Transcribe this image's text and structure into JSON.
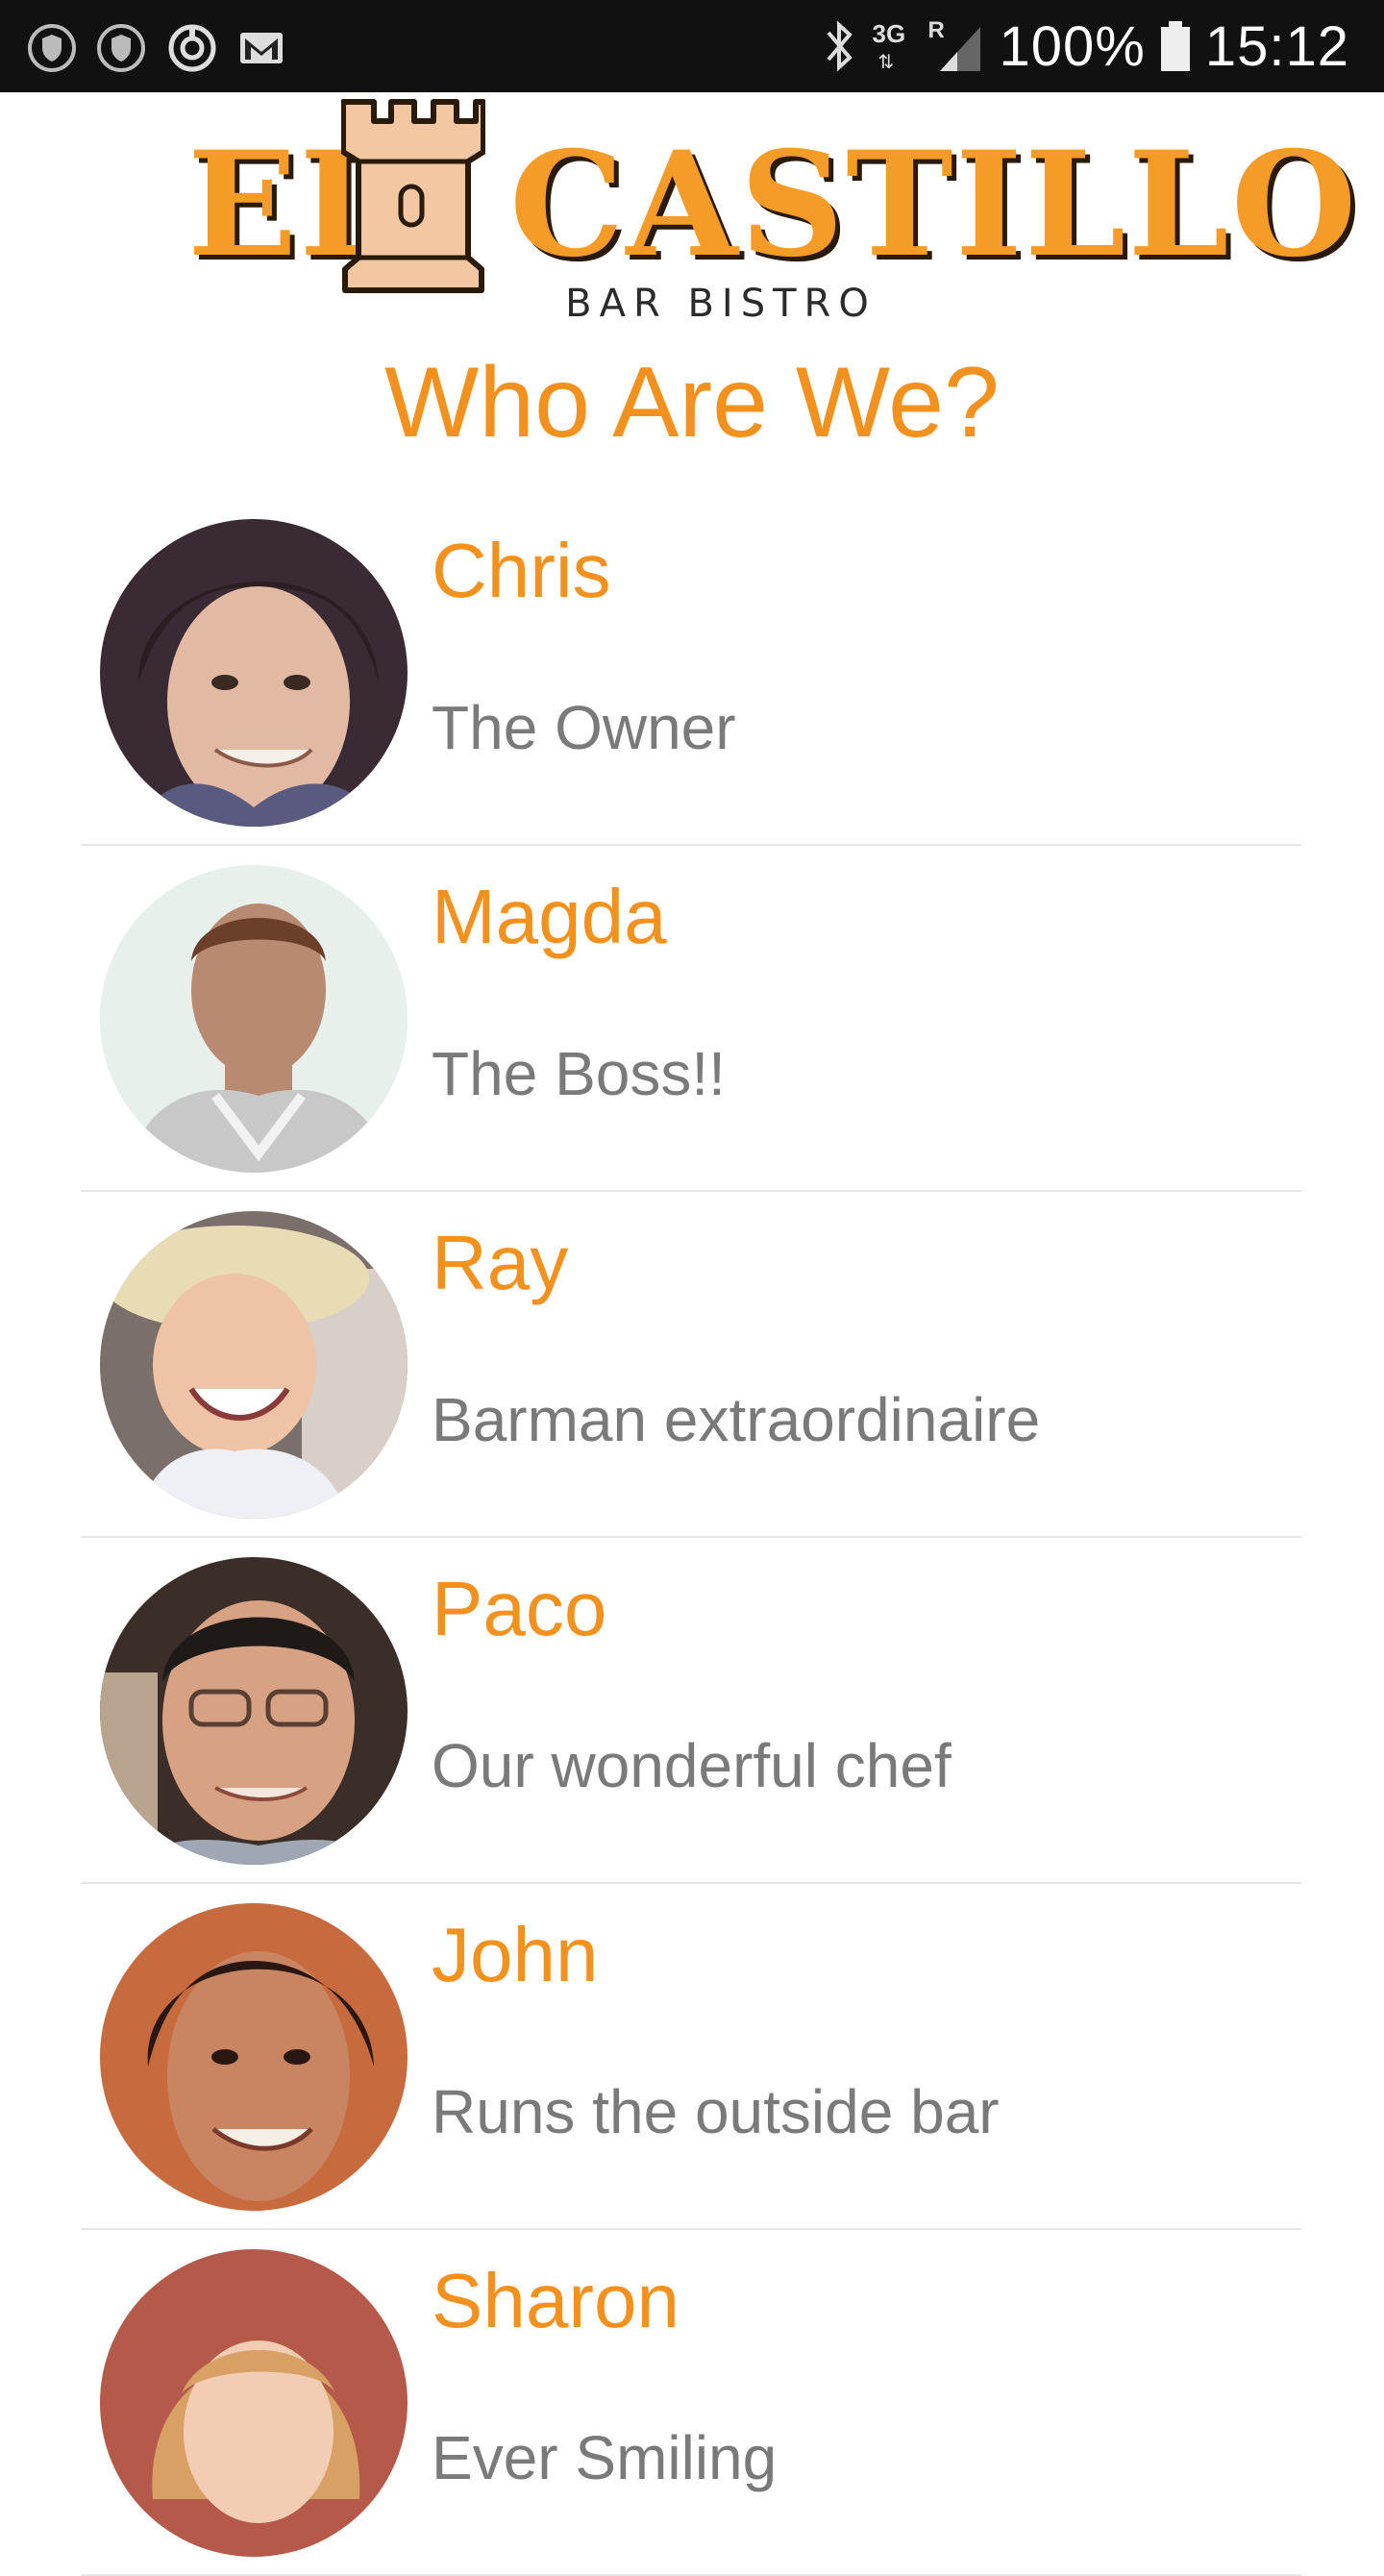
{
  "status_bar": {
    "network": "3G",
    "roaming": "R",
    "battery": "100%",
    "time": "15:12",
    "icons": [
      "shield-icon",
      "shield-icon",
      "sync-icon",
      "gmail-icon",
      "bluetooth-icon",
      "signal-icon",
      "battery-icon"
    ]
  },
  "logo": {
    "word1": "EL",
    "word2": "CASTILLO",
    "subtitle": "BAR BISTRO",
    "brand_color": "#f49b28"
  },
  "page": {
    "title": "Who Are We?",
    "accent_color": "#f3911f",
    "secondary_text_color": "#7a7a7a"
  },
  "team": [
    {
      "name": "Chris",
      "role": "The Owner"
    },
    {
      "name": "Magda",
      "role": "The Boss!!"
    },
    {
      "name": "Ray",
      "role": "Barman extraordinaire"
    },
    {
      "name": "Paco",
      "role": "Our wonderful chef"
    },
    {
      "name": "John",
      "role": "Runs the outside bar"
    },
    {
      "name": "Sharon",
      "role": "Ever Smiling"
    }
  ]
}
